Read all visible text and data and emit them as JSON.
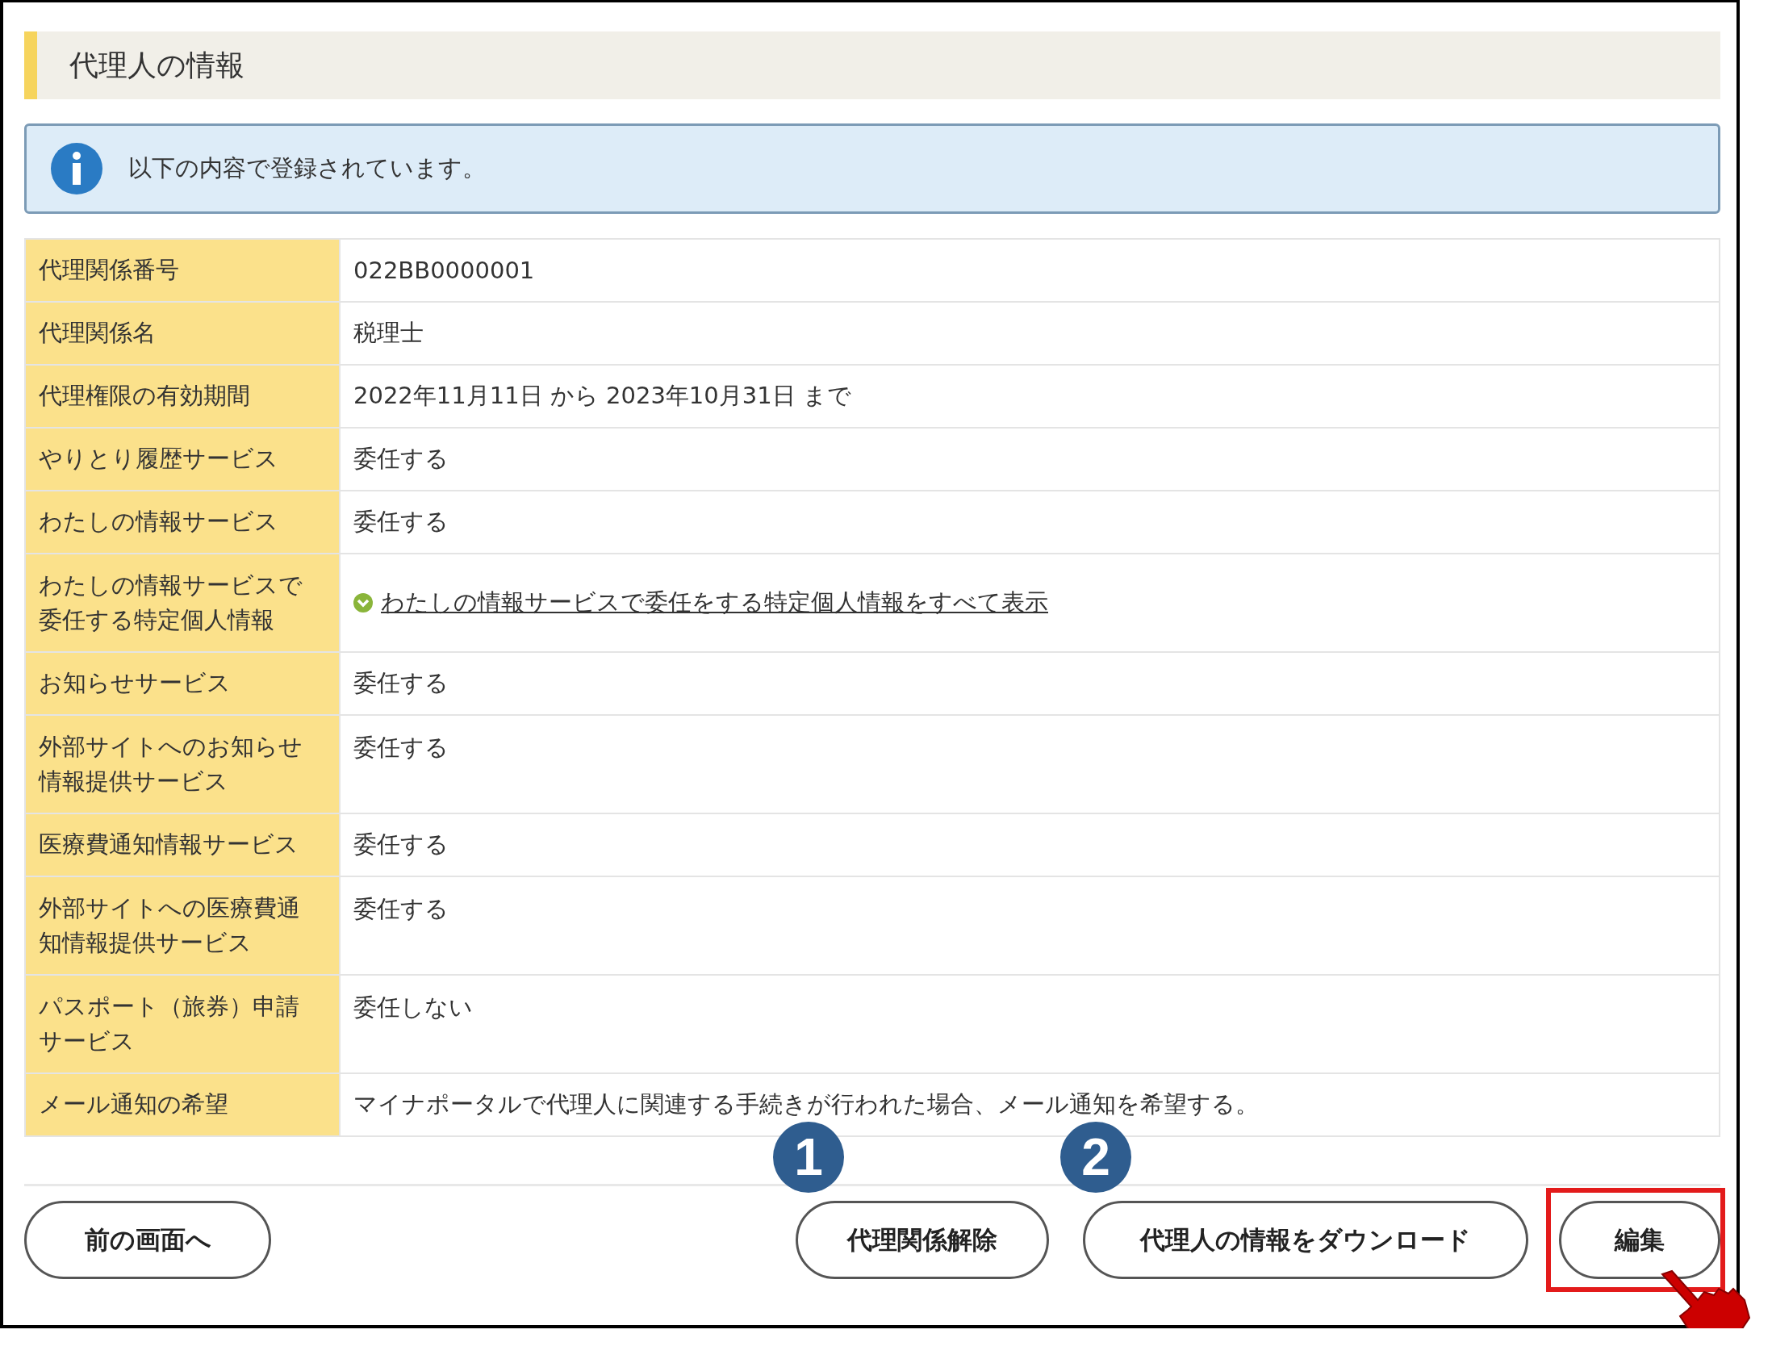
{
  "section_title": "代理人の情報",
  "notice": {
    "text": "以下の内容で登録されています。"
  },
  "rows": [
    {
      "label": "代理関係番号",
      "kind": "text",
      "value": "022BB0000001"
    },
    {
      "label": "代理関係名",
      "kind": "text",
      "value": "税理士"
    },
    {
      "label": "代理権限の有効期間",
      "kind": "text",
      "value": "2022年11月11日 から 2023年10月31日 まで"
    },
    {
      "label": "やりとり履歴サービス",
      "kind": "text",
      "value": "委任する"
    },
    {
      "label": "わたしの情報サービス",
      "kind": "text",
      "value": "委任する"
    },
    {
      "label": "わたしの情報サービスで委任する特定個人情報",
      "kind": "link",
      "value": "わたしの情報サービスで委任をする特定個人情報をすべて表示"
    },
    {
      "label": "お知らせサービス",
      "kind": "text",
      "value": "委任する"
    },
    {
      "label": "外部サイトへのお知らせ情報提供サービス",
      "kind": "text",
      "value": "委任する"
    },
    {
      "label": "医療費通知情報サービス",
      "kind": "text",
      "value": "委任する"
    },
    {
      "label": "外部サイトへの医療費通知情報提供サービス",
      "kind": "text",
      "value": "委任する"
    },
    {
      "label": "パスポート（旅券）申請サービス",
      "kind": "text",
      "value": "委任しない"
    },
    {
      "label": "メール通知の希望",
      "kind": "text",
      "value": "マイナポータルで代理人に関連する手続きが行われた場合、メール通知を希望する。"
    }
  ],
  "buttons": [
    {
      "label": "前の画面へ",
      "kind": "back",
      "highlighted": false
    },
    {
      "label": "代理関係解除",
      "kind": "action",
      "marker": "1",
      "highlighted": false
    },
    {
      "label": "代理人の情報をダウンロード",
      "kind": "action",
      "marker": "2",
      "highlighted": false
    },
    {
      "label": "編集",
      "kind": "action",
      "highlighted": true
    }
  ]
}
